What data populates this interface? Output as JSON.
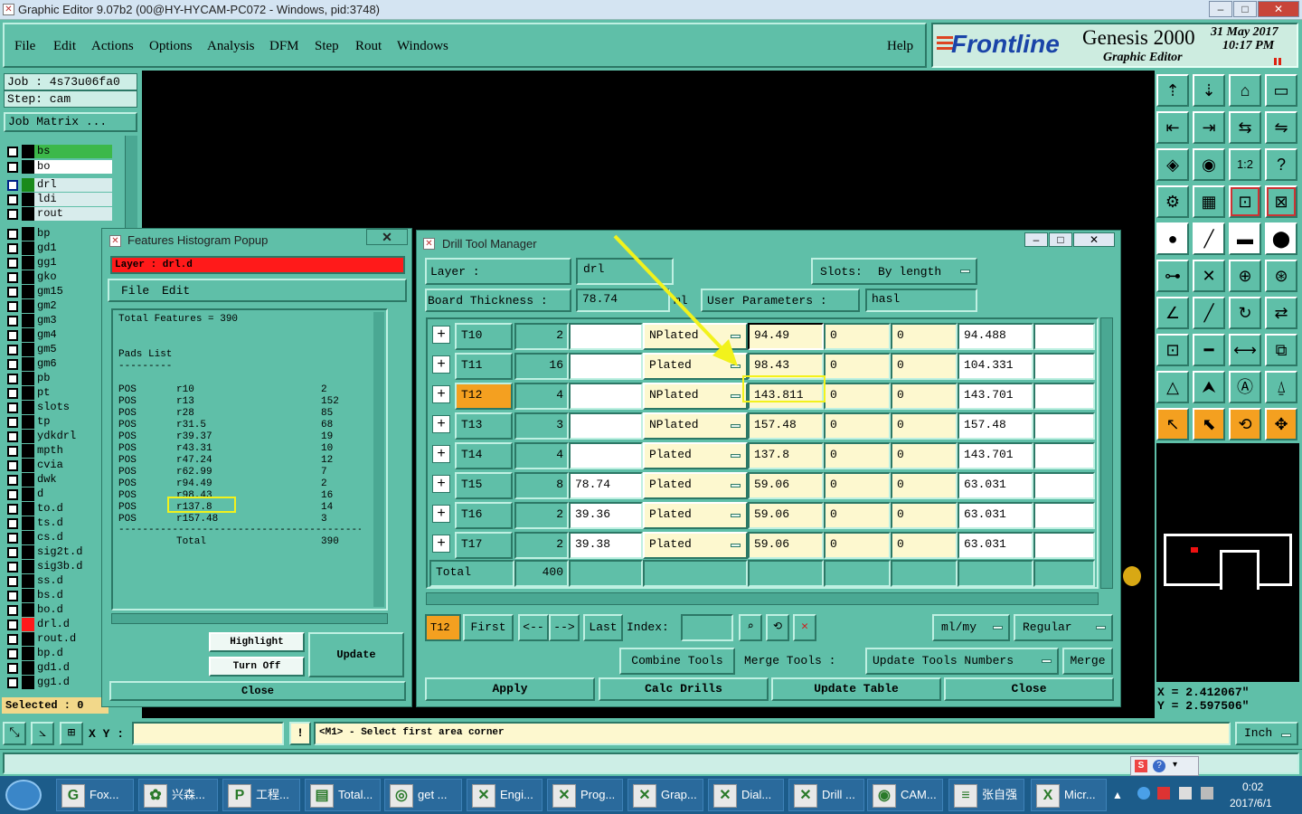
{
  "window": {
    "title": "Graphic Editor 9.07b2 (00@HY-HYCAM-PC072 - Windows, pid:3748)",
    "min": "–",
    "max": "□",
    "close": "✕"
  },
  "menu": {
    "items": [
      "File",
      "Edit",
      "Actions",
      "Options",
      "Analysis",
      "DFM",
      "Step",
      "Rout",
      "Windows"
    ],
    "help": "Help"
  },
  "brand": {
    "logo": "Frontline",
    "product": "Genesis 2000",
    "subtitle": "Graphic Editor",
    "date": "31 May 2017",
    "time": "10:17 PM"
  },
  "left": {
    "job": "Job : 4s73u06fa0",
    "step": "Step: cam",
    "job_matrix": "Job Matrix ...",
    "selected": "Selected : 0",
    "layers": [
      "bs",
      "bo",
      "drl",
      "ldi",
      "rout",
      "bp",
      "gd1",
      "gg1",
      "gko",
      "gm15",
      "gm2",
      "gm3",
      "gm4",
      "gm5",
      "gm6",
      "pb",
      "pt",
      "slots",
      "tp",
      "ydkdrl",
      "mpth",
      "cvia",
      "dwk",
      "d",
      "to.d",
      "ts.d",
      "cs.d",
      "sig2t.d",
      "sig3b.d",
      "ss.d",
      "bs.d",
      "bo.d",
      "drl.d",
      "rout.d",
      "bp.d",
      "gd1.d",
      "gg1.d"
    ]
  },
  "histogram": {
    "title": "Features Histogram Popup",
    "layer": "Layer : drl.d",
    "menu": [
      "File",
      "Edit"
    ],
    "total_features": "Total Features = 390",
    "pads_heading": "Pads List",
    "underline": "---------",
    "rows": [
      [
        "POS",
        "r10",
        "2"
      ],
      [
        "POS",
        "r13",
        "152"
      ],
      [
        "POS",
        "r28",
        "85"
      ],
      [
        "POS",
        "r31.5",
        "68"
      ],
      [
        "POS",
        "r39.37",
        "19"
      ],
      [
        "POS",
        "r43.31",
        "10"
      ],
      [
        "POS",
        "r47.24",
        "12"
      ],
      [
        "POS",
        "r62.99",
        "7"
      ],
      [
        "POS",
        "r94.49",
        "2"
      ],
      [
        "POS",
        "r98.43",
        "16"
      ],
      [
        "POS",
        "r137.8",
        "14"
      ],
      [
        "POS",
        "r157.48",
        "3"
      ]
    ],
    "separator": "------------------------------------------------",
    "total_label": "Total",
    "total_value": "390",
    "btn_highlight": "Highlight",
    "btn_turnoff": "Turn Off",
    "btn_update": "Update",
    "btn_close": "Close"
  },
  "dtm": {
    "title": "Drill Tool Manager",
    "layer_label": "Layer :",
    "layer_value": "drl",
    "slots_label": "Slots:",
    "slots_value": "By length",
    "board_label": "Board Thickness :",
    "board_value": "78.74",
    "board_unit": "ml",
    "user_params_label": "User Parameters :",
    "user_params_value": "hasl",
    "rows": [
      {
        "tool": "T10",
        "count": "2",
        "in": "",
        "type": "NPlated",
        "fin": "94.49",
        "a": "0",
        "b": "0",
        "drill": "94.488"
      },
      {
        "tool": "T11",
        "count": "16",
        "in": "",
        "type": "Plated",
        "fin": "98.43",
        "a": "0",
        "b": "0",
        "drill": "104.331"
      },
      {
        "tool": "T12",
        "count": "4",
        "in": "",
        "type": "NPlated",
        "fin": "143.811",
        "a": "0",
        "b": "0",
        "drill": "143.701"
      },
      {
        "tool": "T13",
        "count": "3",
        "in": "",
        "type": "NPlated",
        "fin": "157.48",
        "a": "0",
        "b": "0",
        "drill": "157.48"
      },
      {
        "tool": "T14",
        "count": "4",
        "in": "",
        "type": "Plated",
        "fin": "137.8",
        "a": "0",
        "b": "0",
        "drill": "143.701"
      },
      {
        "tool": "T15",
        "count": "8",
        "in": "78.74",
        "type": "Plated",
        "fin": "59.06",
        "a": "0",
        "b": "0",
        "drill": "63.031"
      },
      {
        "tool": "T16",
        "count": "2",
        "in": "39.36",
        "type": "Plated",
        "fin": "59.06",
        "a": "0",
        "b": "0",
        "drill": "63.031"
      },
      {
        "tool": "T17",
        "count": "2",
        "in": "39.38",
        "type": "Plated",
        "fin": "59.06",
        "a": "0",
        "b": "0",
        "drill": "63.031"
      }
    ],
    "total_label": "Total",
    "total_value": "400",
    "current_tool": "T12",
    "first": "First",
    "prev": "<--",
    "next": "-->",
    "last": "Last",
    "index_label": "Index:",
    "units": "ml/my",
    "mode": "Regular",
    "combine": "Combine Tools",
    "merge_tools_label": "Merge Tools :",
    "update_numbers": "Update Tools Numbers",
    "merge": "Merge",
    "apply": "Apply",
    "calc": "Calc Drills",
    "update_table": "Update Table",
    "close": "Close"
  },
  "coords": {
    "x": "X = 2.412067\"",
    "y": "Y = 2.597506\""
  },
  "status": {
    "xy_label": "X Y :",
    "message": "<M1> - Select first area corner",
    "unit": "Inch"
  },
  "taskbar": {
    "items": [
      "Fox...",
      "兴森...",
      "工程...",
      "Total...",
      "get ...",
      "Engi...",
      "Prog...",
      "Grap...",
      "Dial...",
      "Drill ...",
      "CAM...",
      "张自强",
      "Micr..."
    ],
    "time": "0:02",
    "date": "2017/6/1"
  },
  "colors": {
    "teal": "#5fbfa8",
    "highlight_yellow": "#f2f21c",
    "accent_orange": "#f4a020",
    "alert_red": "#ff1a1a"
  }
}
